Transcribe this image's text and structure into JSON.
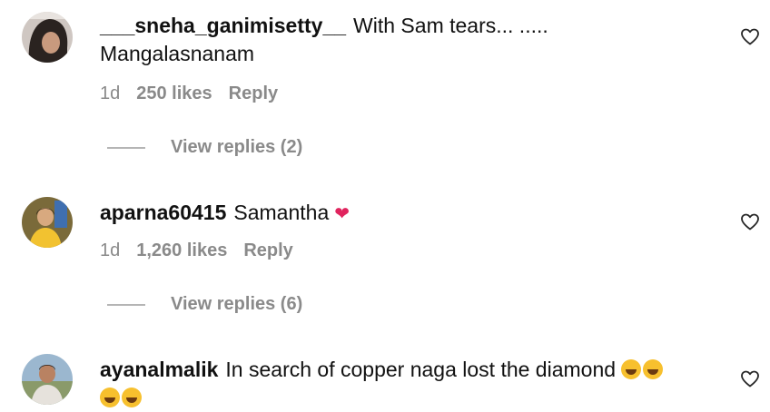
{
  "comments": [
    {
      "username": "___sneha_ganimisetty__",
      "text": "With Sam tears... .....",
      "text_line2": "Mangalasnanam",
      "time": "1d",
      "likes": "250 likes",
      "reply_label": "Reply",
      "view_replies": "View replies (2)",
      "avatar_icon": "user-avatar-dark-hair"
    },
    {
      "username": "aparna60415",
      "text": "Samantha",
      "emoji": "❤",
      "time": "1d",
      "likes": "1,260 likes",
      "reply_label": "Reply",
      "view_replies": "View replies (6)",
      "avatar_icon": "user-avatar-yellow-dress"
    },
    {
      "username": "ayanalmalik",
      "text": "In search of copper naga lost the diamond",
      "avatar_icon": "user-avatar-outdoor"
    }
  ],
  "colors": {
    "text": "#111111",
    "meta": "#8a8a8a",
    "heart": "#e0245e",
    "laugh_emoji": "#f7c02e"
  },
  "icons": {
    "like": "heart-outline-icon",
    "laugh": "face-with-tears-of-joy-emoji"
  }
}
